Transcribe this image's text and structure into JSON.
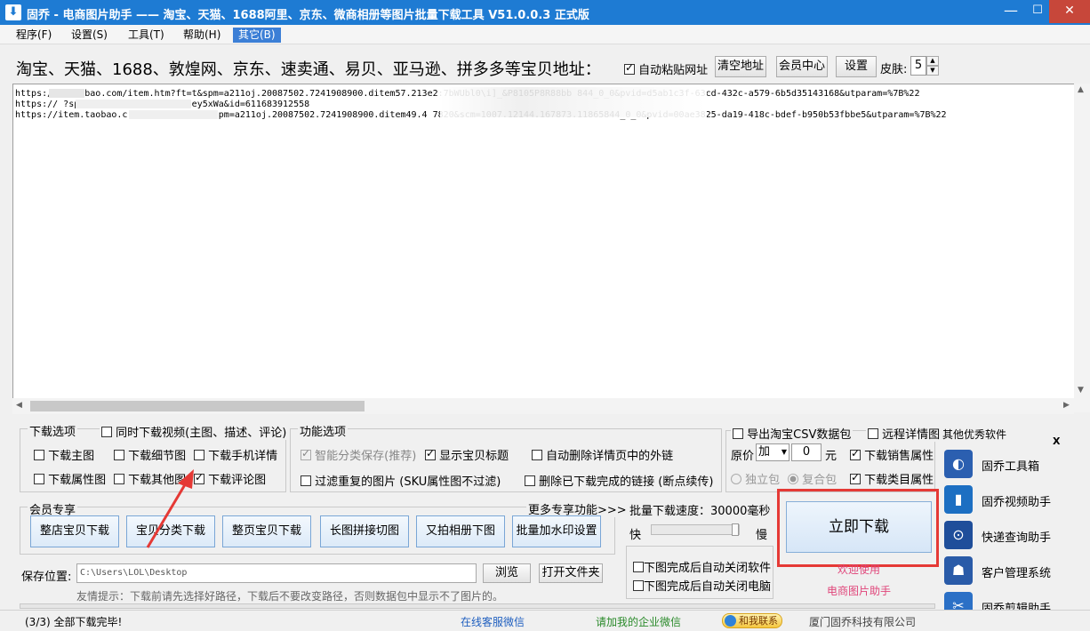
{
  "title_bar": {
    "icon_glyph": "⬇",
    "title": "固乔 - 电商图片助手 —— 淘宝、天猫、1688阿里、京东、微商相册等图片批量下载工具 V51.0.0.3 正式版",
    "minimize": "—",
    "maximize": "☐",
    "close": "✕"
  },
  "menu": [
    "程序(F)",
    "设置(S)",
    "工具(T)",
    "帮助(H)",
    "其它(B)"
  ],
  "toolbar": {
    "label": "淘宝、天猫、1688、敦煌网、京东、速卖通、易贝、亚马逊、拼多多等宝贝地址：",
    "auto_paste": "自动粘贴网址",
    "clear_btn": "清空地址",
    "member_btn": "会员中心",
    "settings_btn": "设置",
    "skin_label": "皮肤:",
    "skin_value": "5",
    "spin_up": "▲",
    "spin_down": "▼"
  },
  "urls": [
    "https://i    taobao.com/item.htm?ft=t&spm=a211oj.20087502.7241908900.ditem57.213e2:7bWUbl0\\i]_&P8105P8R88bb                                    844_0_0&pvid=d5ab1c3f-63cd-432c-a579-6b5d35143168&utparam=%7B%22",
    "https://                   ?spm=2013.1.3.4.6c2074dley5xWa&id=611683912558",
    "https://item.taobao.c               /item.htm?ft=t&spm=a211oj.20087502.7241908900.ditem49.4                                  7820&scm=1007.12144.167873.11865844_0_0&pvid=00ae3825-da19-418c-bdef-b950b53fbbe5&utparam=%7B%22"
  ],
  "scroll": {
    "up": "▲",
    "down": "▼",
    "left": "◀",
    "right": "▶"
  },
  "download_options": {
    "legend": "下载选项",
    "video": "同时下载视频(主图、描述、评论)",
    "main_img": "下载主图",
    "detail_img": "下载细节图",
    "mobile_detail": "下载手机详情",
    "attr_img": "下载属性图",
    "other_img": "下载其他图",
    "review_img": "下载评论图"
  },
  "func_options": {
    "legend": "功能选项",
    "smart_sort": "智能分类保存(推荐)",
    "show_title": "显示宝贝标题",
    "auto_delete_links": "自动删除详情页中的外链",
    "filter_dup": "过滤重复的图片 (SKU属性图不过滤)",
    "delete_done": "删除已下载完成的链接 (断点续传)"
  },
  "csv": {
    "export_csv": "导出淘宝CSV数据包",
    "remote_detail": "远程详情图",
    "original_price": "原价",
    "op_value": "加",
    "op_arrow": "▼",
    "amount": "0",
    "unit": "元",
    "sales_attr": "下载销售属性",
    "standalone": "独立包",
    "combined": "复合包",
    "category_attr": "下载类目属性"
  },
  "member": {
    "legend": "会员专享",
    "more": "更多专享功能>>>",
    "buttons": [
      "整店宝贝下载",
      "宝贝分类下载",
      "整页宝贝下载",
      "长图拼接切图",
      "又拍相册下图",
      "批量加水印设置"
    ]
  },
  "speed": {
    "label": "批量下载速度：30000毫秒",
    "fast": "快",
    "slow": "慢",
    "slider_level": 1.0,
    "close_app": "下图完成后自动关闭软件",
    "shutdown": "下图完成后自动关闭电脑"
  },
  "download_now": "立即下载",
  "welcome1": "欢迎使用",
  "welcome2": "电商图片助手",
  "save": {
    "label": "保存位置:",
    "path": "C:\\Users\\LOL\\Desktop",
    "browse": "浏览",
    "open": "打开文件夹",
    "tip": "友情提示：下载前请先选择好路径，下载后不要改变路径，否则数据包中显示不了图片的。"
  },
  "other_software": {
    "title": "其他优秀软件",
    "close": "X",
    "items": [
      {
        "label": "固乔工具箱",
        "glyph": "◐"
      },
      {
        "label": "固乔视频助手",
        "glyph": "▮"
      },
      {
        "label": "快递查询助手",
        "glyph": "⊙"
      },
      {
        "label": "客户管理系统",
        "glyph": "☗"
      },
      {
        "label": "固乔剪辑助手",
        "glyph": "✂"
      }
    ]
  },
  "status": {
    "progress": "(3/3) 全部下载完毕!",
    "service": "在线客服微信",
    "wechat": "请加我的企业微信",
    "contact": "和我联系",
    "company": "厦门固乔科技有限公司"
  },
  "colors": {
    "title_bar": "#1e7bd3",
    "highlight_red": "#e53935",
    "link_blue": "#1f5fbf",
    "link_green": "#2a8a2a",
    "welcome_pink": "#e0457a"
  }
}
